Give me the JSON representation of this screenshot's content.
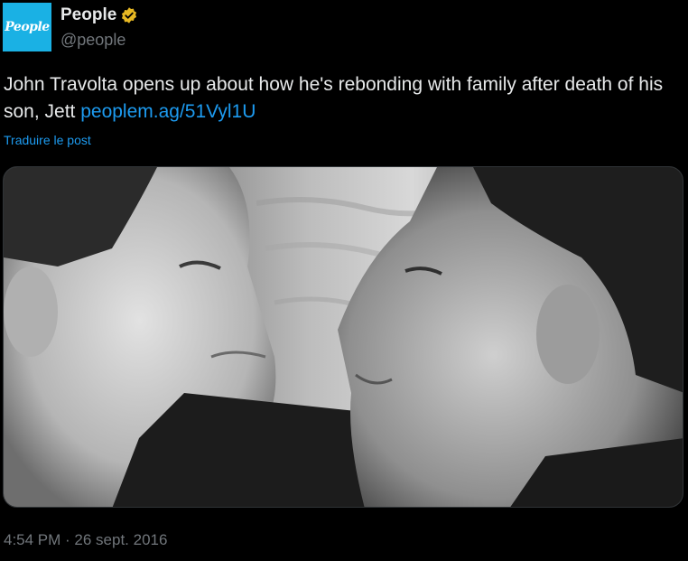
{
  "account": {
    "avatar_text": "People",
    "display_name": "People",
    "handle": "@people",
    "verified": true,
    "verified_color": "#e8b923",
    "avatar_color": "#1ab1e4"
  },
  "tweet": {
    "text_before_link": "John Travolta opens up about how he's rebonding with family after death of his son, Jett ",
    "link_text": "peoplem.ag/51Vyl1U",
    "translate_label": "Traduire le post",
    "media_icon": "photo-black-and-white",
    "timestamp": "4:54 PM · 26 sept. 2016"
  },
  "colors": {
    "background": "#000000",
    "text": "#e7e9ea",
    "link": "#1d9bf0",
    "muted": "#71767b"
  }
}
